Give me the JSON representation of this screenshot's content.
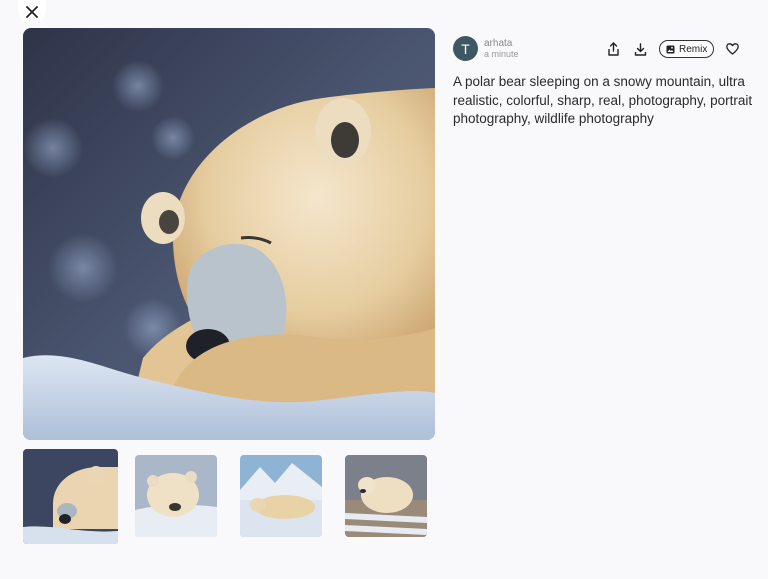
{
  "close": {
    "icon": "close-icon"
  },
  "author": {
    "avatar_letter": "T",
    "name": "arhata",
    "time": "a minute"
  },
  "actions": {
    "share_icon": "share-icon",
    "download_icon": "download-icon",
    "remix_label": "Remix",
    "remix_icon": "image-icon",
    "like_icon": "heart-icon"
  },
  "prompt": "A polar bear sleeping on a snowy mountain, ultra realistic, colorful, sharp, real, photography, portrait photography, wildlife photography",
  "thumbnails": [
    {
      "label": "variation-1",
      "selected": true
    },
    {
      "label": "variation-2",
      "selected": false
    },
    {
      "label": "variation-3",
      "selected": false
    },
    {
      "label": "variation-4",
      "selected": false
    }
  ]
}
